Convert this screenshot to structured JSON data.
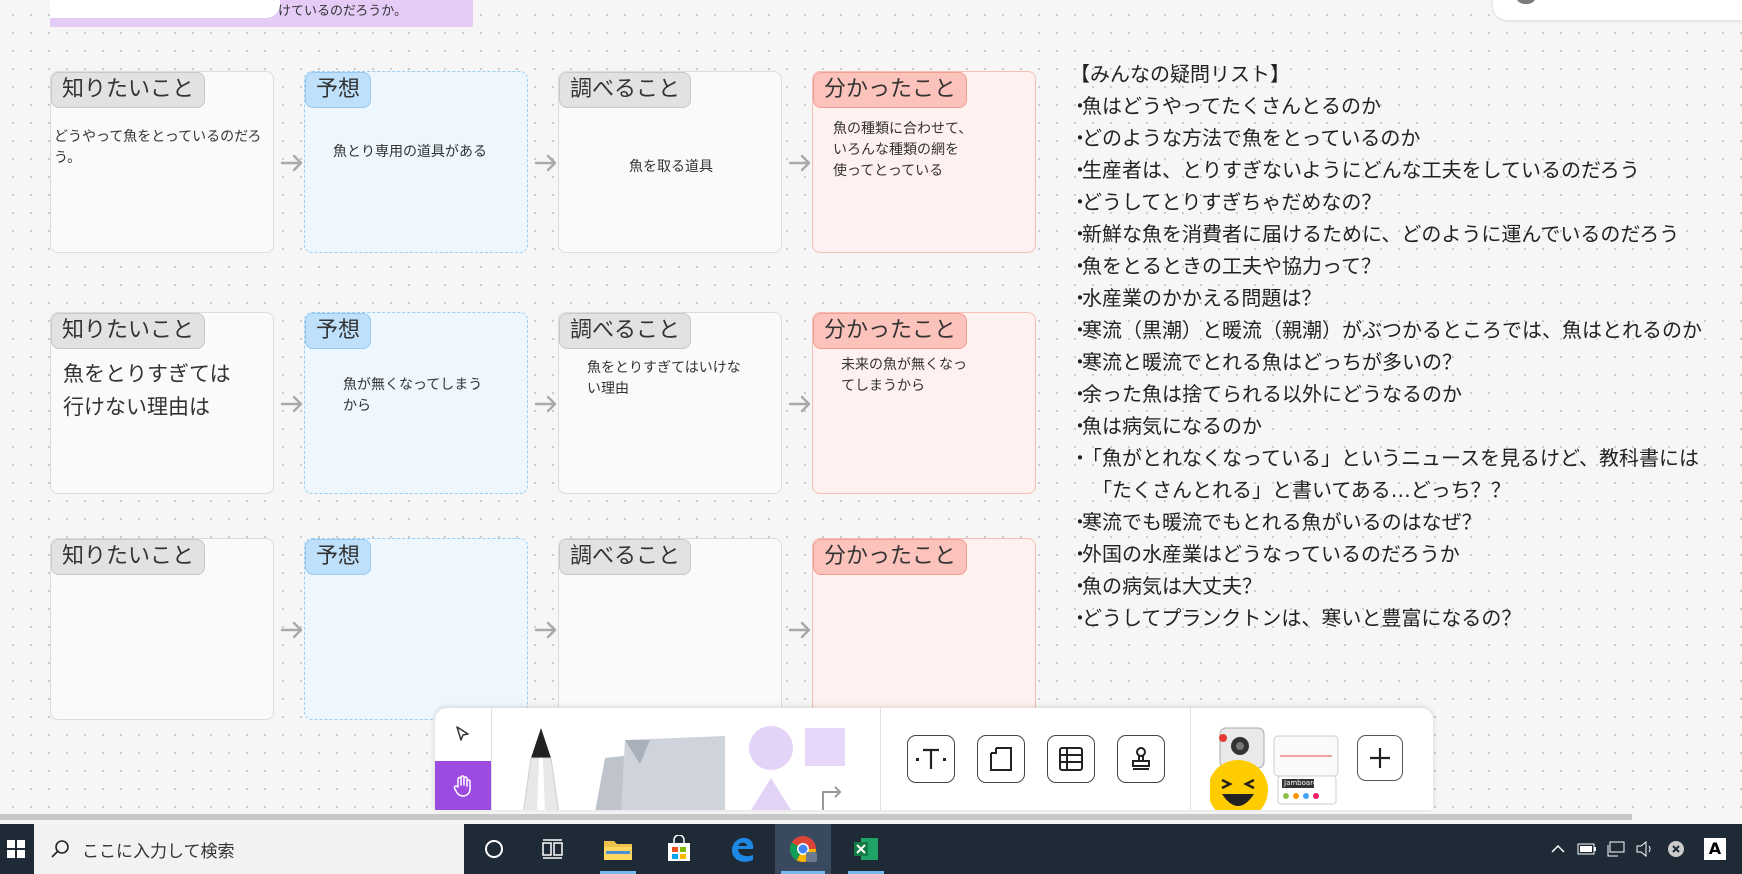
{
  "top_banner": {
    "text": "けているのだろうか。"
  },
  "rows": [
    {
      "want_tag": "知りたいこと",
      "want_text": "どうやって魚をとっているのだろう。",
      "guess_tag": "予想",
      "guess_text": "魚とり専用の道具がある",
      "research_tag": "調べること",
      "research_text": "魚を取る道具",
      "found_tag": "分かったこと",
      "found_text": "魚の種類に合わせて、\nいろんな種類の網を\n使ってとっている"
    },
    {
      "want_tag": "知りたいこと",
      "want_text": "魚をとりすぎては\n行けない理由は",
      "guess_tag": "予想",
      "guess_text": "魚が無くなってしまう\nから",
      "research_tag": "調べること",
      "research_text": "魚をとりすぎてはいけな\nい理由",
      "found_tag": "分かったこと",
      "found_text": "未来の魚が無くなっ\nてしまうから"
    },
    {
      "want_tag": "知りたいこと",
      "want_text": "",
      "guess_tag": "予想",
      "guess_text": "",
      "research_tag": "調べること",
      "research_text": "",
      "found_tag": "分かったこと",
      "found_text": ""
    }
  ],
  "question_list": {
    "title": "【みんなの疑問リスト】",
    "bullet": "・",
    "items": [
      "魚はどうやってたくさんとるのか",
      "どのような方法で魚をとっているのか",
      "生産者は、とりすぎないようにどんな工夫をしているのだろう",
      "どうしてとりすぎちゃだめなの？",
      "新鮮な魚を消費者に届けるために、どのように運んでいるのだろう",
      "魚をとるときの工夫や協力って？",
      "水産業のかかえる問題は？",
      "寒流（黒潮）と暖流（親潮）がぶつかるところでは、魚はとれるのか",
      "寒流と暖流でとれる魚はどっちが多いの？",
      "余った魚は捨てられる以外にどうなるのか",
      "魚は病気になるのか",
      "「魚がとれなくなっている」というニュースを見るけど、教科書には",
      "　「たくさんとれる」と書いてある…どっち？？",
      "寒流でも暖流でもとれる魚がいるのはなぜ？",
      "外国の水産業はどうなっているのだろうか",
      "魚の病気は大丈夫？",
      "どうしてプランクトンは、寒いと豊富になるの？"
    ]
  },
  "toolbar": {
    "select_tool": "select-arrow-icon",
    "hand_tool": "hand-icon",
    "sticker_label": "Jamboard"
  },
  "taskbar": {
    "search_placeholder": "ここに入力して検索",
    "accent": "#76b9ed",
    "ime_label": "A"
  }
}
